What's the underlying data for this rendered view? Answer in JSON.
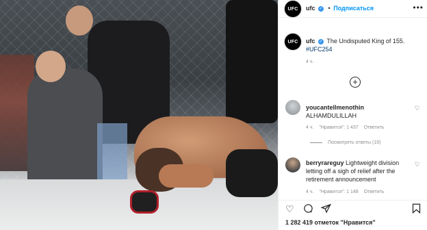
{
  "header": {
    "avatar_text": "UFC",
    "username": "ufc",
    "follow_label": "Подписаться",
    "more_label": "•••"
  },
  "caption": {
    "avatar_text": "UFC",
    "username": "ufc",
    "text": "The Undisputed King of 155.",
    "hashtag": "#UFC254",
    "time": "4 ч."
  },
  "load_more_label": "+",
  "comments": [
    {
      "username": "youcantellmenothin",
      "text": "ALHAMDULILLAH",
      "time": "4 ч.",
      "likes": "\"Нравится\": 1 437",
      "reply_label": "Ответить",
      "view_replies": "Посмотреть ответы (19)"
    },
    {
      "username": "berryrareguy",
      "text": "Lightweight division letting off a sigh of relief after the retirement announcement",
      "time": "4 ч.",
      "likes": "\"Нравится\": 1 148",
      "reply_label": "Ответить"
    }
  ],
  "actions": {
    "like_icon": "heart-outline",
    "comment_icon": "speech-bubble",
    "share_icon": "paper-plane",
    "save_icon": "bookmark"
  },
  "likes_summary": "1 282 419 отметок \"Нравится\"",
  "colors": {
    "link_blue": "#0095f6",
    "hashtag": "#00376b",
    "muted": "#8e8e8e"
  }
}
